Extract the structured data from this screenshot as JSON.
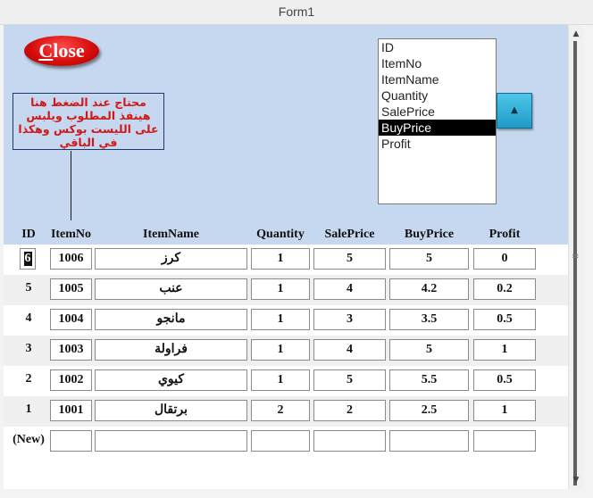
{
  "window": {
    "title": "Form1"
  },
  "close_button": {
    "label_first": "C",
    "label_rest": "lose"
  },
  "note": {
    "text": "محتاج عند الضغط هنا هينفذ المطلوب ويلبس على الليست بوكس وهكذا في الباقي"
  },
  "listbox": {
    "items": [
      "ID",
      "ItemNo",
      "ItemName",
      "Quantity",
      "SalePrice",
      "BuyPrice",
      "Profit"
    ],
    "selected_index": 5
  },
  "up_button": {
    "icon": "triangle-up-icon",
    "glyph": "▲"
  },
  "grid": {
    "headers": [
      "ID",
      "ItemNo",
      "ItemName",
      "Quantity",
      "SalePrice",
      "BuyPrice",
      "Profit"
    ],
    "rows": [
      [
        "6",
        "1006",
        "كرز",
        "1",
        "5",
        "5",
        "0"
      ],
      [
        "5",
        "1005",
        "عنب",
        "1",
        "4",
        "4.2",
        "0.2"
      ],
      [
        "4",
        "1004",
        "مانجو",
        "1",
        "3",
        "3.5",
        "0.5"
      ],
      [
        "3",
        "1003",
        "فراولة",
        "1",
        "4",
        "5",
        "1"
      ],
      [
        "2",
        "1002",
        "كيوي",
        "1",
        "5",
        "5.5",
        "0.5"
      ],
      [
        "1",
        "1001",
        "برتقال",
        "2",
        "2",
        "2.5",
        "1"
      ]
    ],
    "new_row_label": "(New)"
  },
  "colors": {
    "panel": "#c6d8ef",
    "close": "#d70e0e",
    "note_text": "#d11818",
    "selection": "#000000"
  }
}
